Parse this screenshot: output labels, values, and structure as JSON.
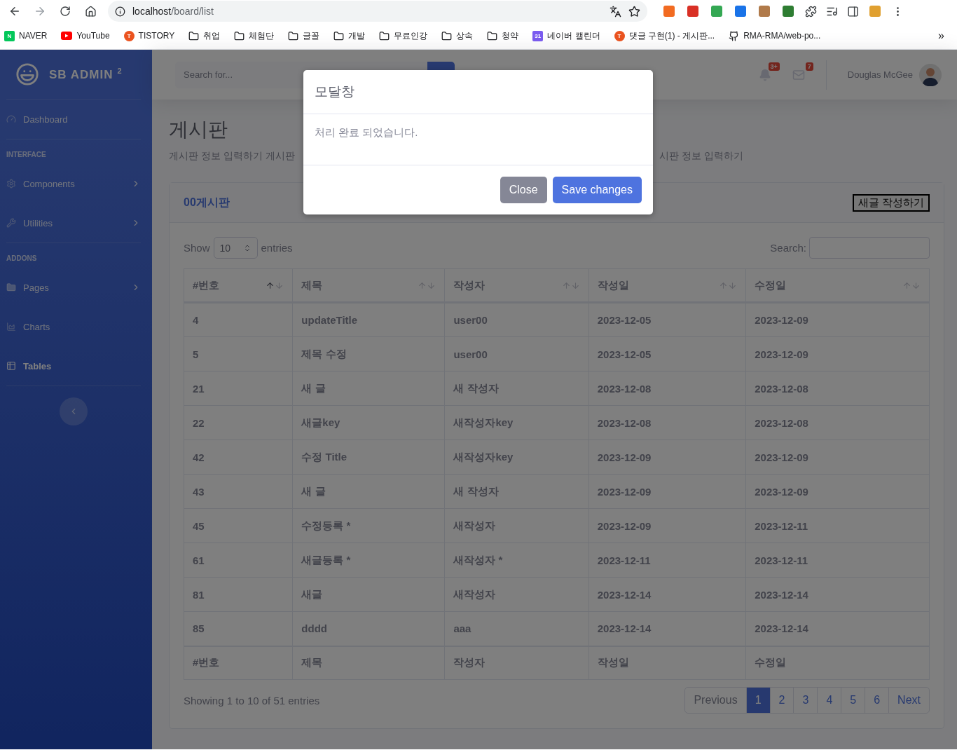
{
  "browser": {
    "url_host": "localhost",
    "url_path": "/board/list",
    "bookmarks": [
      {
        "label": "NAVER",
        "kind": "naver",
        "badge": "N"
      },
      {
        "label": "YouTube",
        "kind": "youtube"
      },
      {
        "label": "TISTORY",
        "kind": "tistory",
        "badge": "T"
      },
      {
        "label": "취업",
        "kind": "folder"
      },
      {
        "label": "체험단",
        "kind": "folder"
      },
      {
        "label": "글꼴",
        "kind": "folder"
      },
      {
        "label": "개발",
        "kind": "folder"
      },
      {
        "label": "무료인강",
        "kind": "folder"
      },
      {
        "label": "상속",
        "kind": "folder"
      },
      {
        "label": "청약",
        "kind": "folder"
      },
      {
        "label": "네이버 캘린더",
        "kind": "calendar",
        "badge": "31"
      },
      {
        "label": "댓글 구현(1) - 게시판...",
        "kind": "tistory",
        "badge": "T"
      },
      {
        "label": "RMA-RMA/web-po...",
        "kind": "github"
      }
    ],
    "more": "»"
  },
  "sidebar": {
    "brand": "SB ADMIN",
    "brand_sup": "2",
    "items": [
      {
        "kind": "link",
        "label": "Dashboard",
        "chevron": false,
        "selected": false
      },
      {
        "kind": "divider"
      },
      {
        "kind": "heading",
        "label": "INTERFACE"
      },
      {
        "kind": "link",
        "label": "Components",
        "chevron": true,
        "selected": false
      },
      {
        "kind": "link",
        "label": "Utilities",
        "chevron": true,
        "selected": false
      },
      {
        "kind": "divider"
      },
      {
        "kind": "heading",
        "label": "ADDONS"
      },
      {
        "kind": "link",
        "label": "Pages",
        "chevron": true,
        "selected": false
      },
      {
        "kind": "link",
        "label": "Charts",
        "chevron": false,
        "selected": false
      },
      {
        "kind": "link",
        "label": "Tables",
        "chevron": false,
        "selected": true
      },
      {
        "kind": "divider"
      }
    ]
  },
  "topbar": {
    "search": {
      "placeholder": "Search for..."
    },
    "alerts_badge": "3+",
    "messages_badge": "7",
    "user_name": "Douglas McGee"
  },
  "page": {
    "title": "게시판",
    "subtitle_left": "게시판 정보 입력하기 게시판",
    "subtitle_right": "시판 정보 입력하기"
  },
  "card": {
    "title": "00게시판",
    "new_button": "새글 작성하기",
    "show_label": "Show",
    "page_size": "10",
    "entries_label": "entries",
    "search_label": "Search:",
    "columns": [
      {
        "label": "#번호",
        "sorted": true
      },
      {
        "label": "제목",
        "sorted": false
      },
      {
        "label": "작성자",
        "sorted": false
      },
      {
        "label": "작성일",
        "sorted": false
      },
      {
        "label": "수정일",
        "sorted": false
      }
    ],
    "rows": [
      [
        "4",
        "updateTitle",
        "user00",
        "2023-12-05",
        "2023-12-09"
      ],
      [
        "5",
        "제목 수정",
        "user00",
        "2023-12-05",
        "2023-12-09"
      ],
      [
        "21",
        "새 글",
        "새 작성자",
        "2023-12-08",
        "2023-12-08"
      ],
      [
        "22",
        "새글key",
        "새작성자key",
        "2023-12-08",
        "2023-12-08"
      ],
      [
        "42",
        "수정 Title",
        "새작성자key",
        "2023-12-09",
        "2023-12-09"
      ],
      [
        "43",
        "새 글",
        "새 작성자",
        "2023-12-09",
        "2023-12-09"
      ],
      [
        "45",
        "수정등록 *",
        "새작성자",
        "2023-12-09",
        "2023-12-11"
      ],
      [
        "61",
        "새글등록 *",
        "새작성자 *",
        "2023-12-11",
        "2023-12-11"
      ],
      [
        "81",
        "새글",
        "새작성자",
        "2023-12-14",
        "2023-12-14"
      ],
      [
        "85",
        "dddd",
        "aaa",
        "2023-12-14",
        "2023-12-14"
      ]
    ],
    "footer_columns": [
      "#번호",
      "제목",
      "작성자",
      "작성일",
      "수정일"
    ],
    "info": "Showing 1 to 10 of 51 entries",
    "pagination": [
      {
        "label": "Previous",
        "selected": false,
        "disabled": true
      },
      {
        "label": "1",
        "selected": true,
        "disabled": false
      },
      {
        "label": "2",
        "selected": false,
        "disabled": false
      },
      {
        "label": "3",
        "selected": false,
        "disabled": false
      },
      {
        "label": "4",
        "selected": false,
        "disabled": false
      },
      {
        "label": "5",
        "selected": false,
        "disabled": false
      },
      {
        "label": "6",
        "selected": false,
        "disabled": false
      },
      {
        "label": "Next",
        "selected": false,
        "disabled": false
      }
    ]
  },
  "modal": {
    "title": "모달창",
    "body": "처리 완료 되었습니다.",
    "buttons": [
      {
        "label": "Close",
        "kind": "secondary"
      },
      {
        "label": "Save changes",
        "kind": "primary"
      }
    ]
  }
}
